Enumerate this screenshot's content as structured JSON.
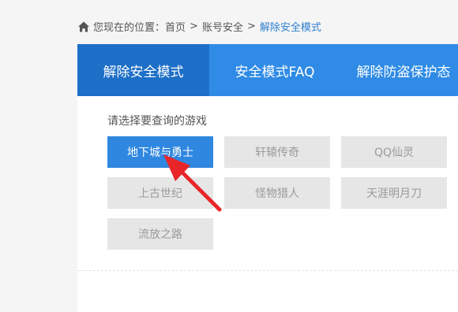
{
  "breadcrumb": {
    "prefix": "您现在的位置：",
    "items": [
      "首页",
      "账号安全",
      "解除安全模式"
    ],
    "separator": ">"
  },
  "tabs": [
    {
      "label": "解除安全模式",
      "active": true
    },
    {
      "label": "安全模式FAQ",
      "active": false
    },
    {
      "label": "解除防盗保护态",
      "active": false
    }
  ],
  "game_select": {
    "prompt": "请选择要查询的游戏",
    "games": [
      "地下城与勇士",
      "轩辕传奇",
      "QQ仙灵",
      "上古世纪",
      "怪物猎人",
      "天涯明月刀",
      "流放之路"
    ],
    "selected": "地下城与勇士"
  },
  "colors": {
    "accent": "#2f8be5",
    "tab_active": "#1d6fc7",
    "annotation_arrow": "#e8262a"
  },
  "icons": {
    "breadcrumb": "home-icon",
    "annotation": "red-arrow"
  }
}
